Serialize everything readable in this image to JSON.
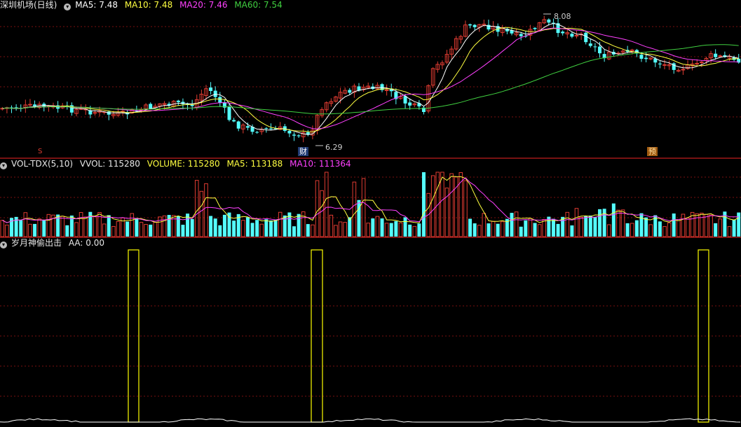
{
  "price_header": {
    "title": "深圳机场(日线)",
    "ma5_label": "MA5: 7.48",
    "ma10_label": "MA10: 7.48",
    "ma20_label": "MA20: 7.46",
    "ma60_label": "MA60: 7.54"
  },
  "vol_header": {
    "title": "VOL-TDX(5,10)",
    "vvol_label": "VVOL: 115280",
    "volume_label": "VOLUME: 115280",
    "ma5_label": "MA5: 113188",
    "ma10_label": "MA10: 111364"
  },
  "ind_header": {
    "title": "岁月神偷出击",
    "aa_label": "AA: 0.00"
  },
  "annotations": {
    "high_price": "8.08",
    "low_price": "6.29",
    "marker_s": "S",
    "marker_cai": "财",
    "marker_yu": "预"
  },
  "colors": {
    "background": "#000000",
    "grid": "#7a1010",
    "separator": "#a01818",
    "up": "#e03c32",
    "down": "#54fcfc",
    "ma5": "#ffffff",
    "ma10": "#ffff40",
    "ma20": "#ff40ff",
    "ma60": "#40d040",
    "signal": "#ffff00"
  },
  "icons": {
    "collapse_toggle": "chevron-down-icon"
  }
}
